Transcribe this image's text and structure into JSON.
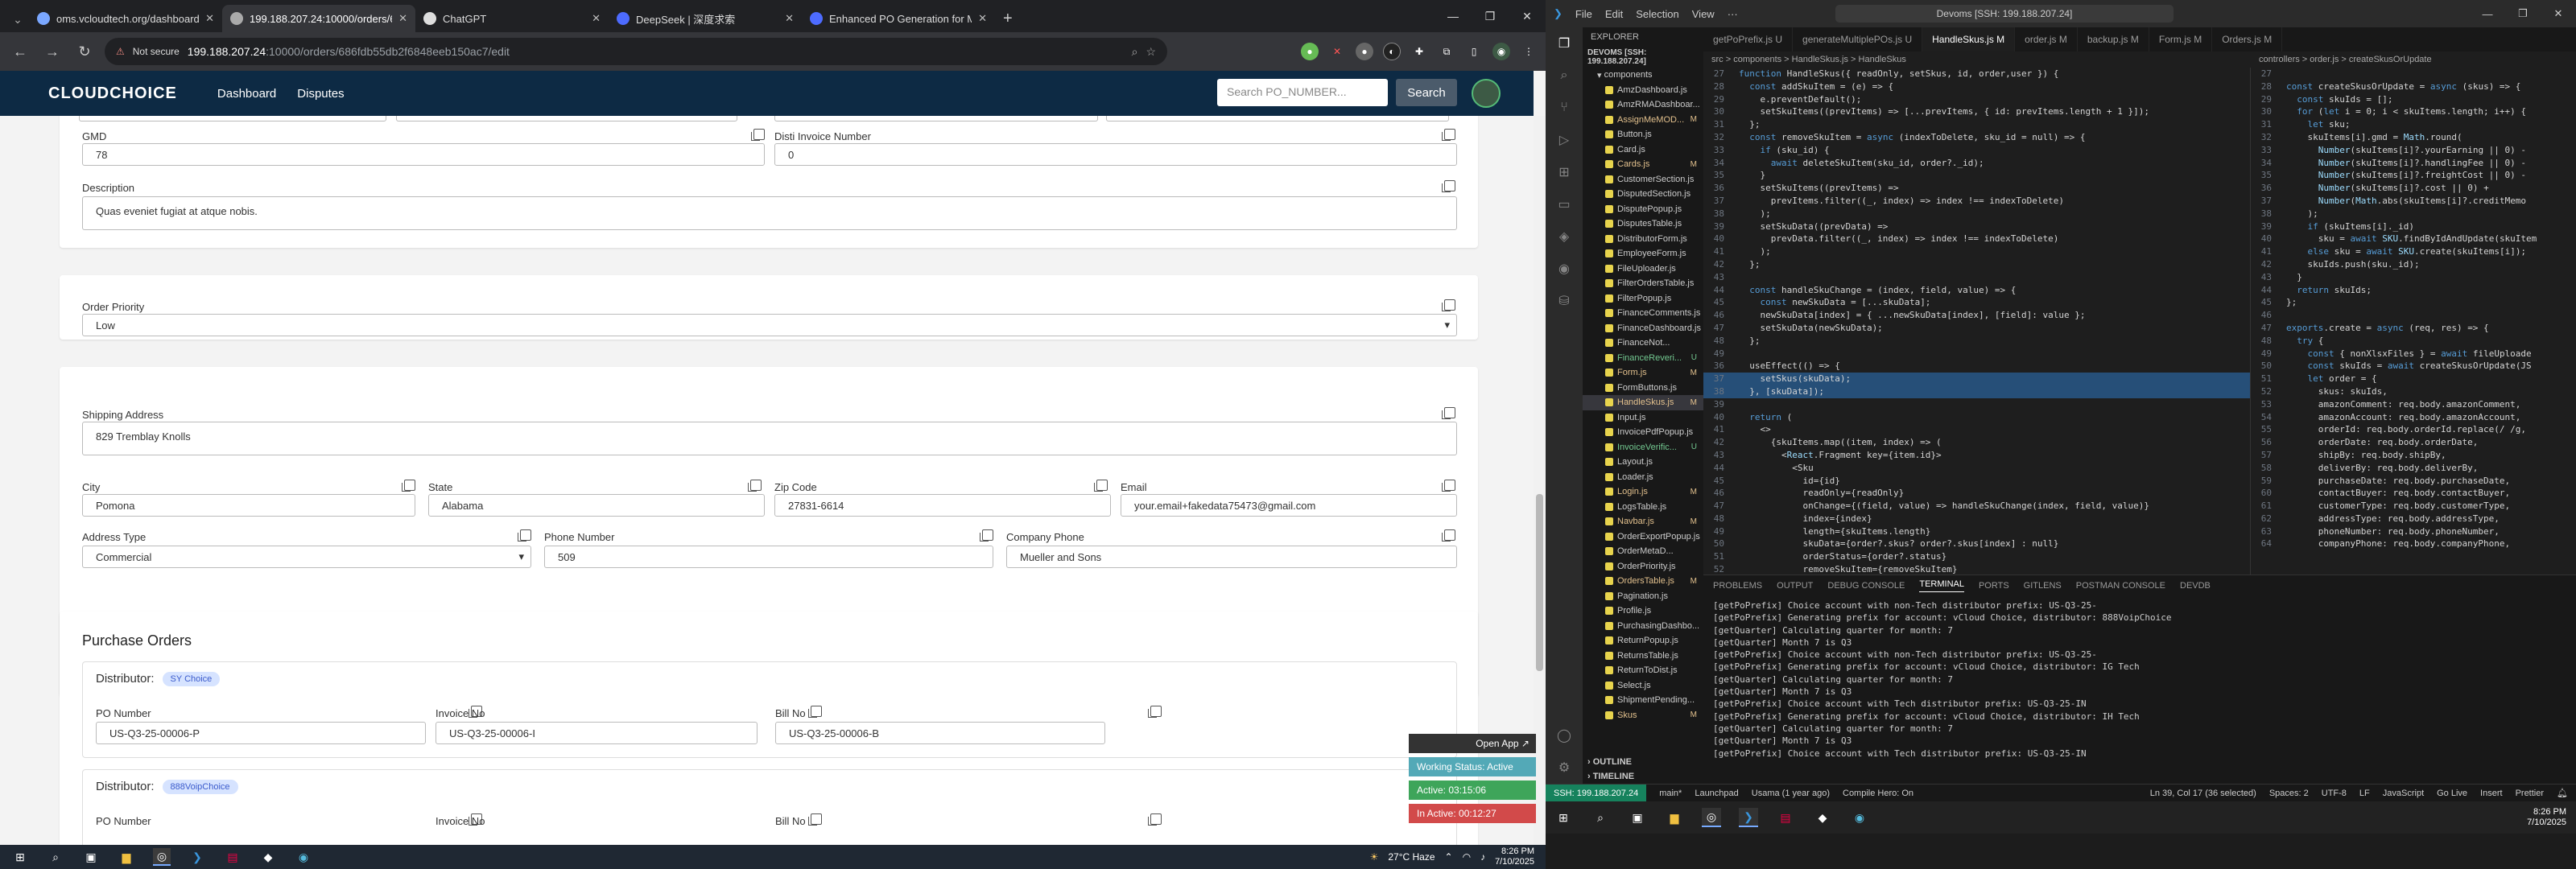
{
  "browser": {
    "tabs": [
      {
        "title": "oms.vcloudtech.org/dashboard",
        "active": false
      },
      {
        "title": "199.188.207.24:10000/orders/6",
        "active": true
      },
      {
        "title": "ChatGPT",
        "active": false
      },
      {
        "title": "DeepSeek | 深度求索",
        "active": false
      },
      {
        "title": "Enhanced PO Generation for M",
        "active": false
      }
    ],
    "address": {
      "security": "Not secure",
      "host": "199.188.207.24",
      "path": ":10000/orders/686fdb55db2f6848eeb150ac7/edit"
    }
  },
  "app": {
    "logo": "CLOUDCHOICE",
    "nav": [
      "Dashboard",
      "Disputes"
    ],
    "search_placeholder": "Search PO_NUMBER...",
    "search_button": "Search"
  },
  "form": {
    "gmd": {
      "label": "GMD",
      "value": "78"
    },
    "disti_invoice": {
      "label": "Disti Invoice Number",
      "value": "0"
    },
    "description": {
      "label": "Description",
      "value": "Quas eveniet fugiat at atque nobis."
    },
    "order_priority": {
      "label": "Order Priority",
      "value": "Low"
    },
    "shipping_address": {
      "label": "Shipping Address",
      "value": "829 Tremblay Knolls"
    },
    "city": {
      "label": "City",
      "value": "Pomona"
    },
    "state": {
      "label": "State",
      "value": "Alabama"
    },
    "zip": {
      "label": "Zip Code",
      "value": "27831-6614"
    },
    "email": {
      "label": "Email",
      "value": "your.email+fakedata75473@gmail.com"
    },
    "address_type": {
      "label": "Address Type",
      "value": "Commercial"
    },
    "phone": {
      "label": "Phone Number",
      "value": "509"
    },
    "company_phone": {
      "label": "Company Phone",
      "value": "Mueller and Sons"
    }
  },
  "purchase_orders": {
    "heading": "Purchase Orders",
    "distributor_label": "Distributor:",
    "items": [
      {
        "badge": "SY Choice",
        "po_label": "PO Number",
        "po": "US-Q3-25-00006-P",
        "inv_label": "Invoice No",
        "inv": "US-Q3-25-00006-I",
        "bill_label": "Bill No",
        "bill": "US-Q3-25-00006-B"
      },
      {
        "badge": "888VoipChoice",
        "po_label": "PO Number",
        "inv_label": "Invoice No",
        "bill_label": "Bill No"
      }
    ]
  },
  "status_widget": {
    "open_app": "Open App ↗",
    "working": "Working Status: Active",
    "active": "Active: 03:15:06",
    "inactive": "In Active: 00:12:27"
  },
  "taskbar": {
    "weather": "27°C Haze",
    "time": "8:26 PM",
    "date": "7/10/2025"
  },
  "vscode": {
    "menu": [
      "File",
      "Edit",
      "Selection",
      "View"
    ],
    "search": "Devoms [SSH: 199.188.207.24]",
    "explorer": {
      "title": "EXPLORER",
      "root": "DEVOMS [SSH: 199.188.207.24]",
      "folder": "components",
      "files": [
        {
          "n": "AmzDashboard.js",
          "s": "",
          "c": "#ccc"
        },
        {
          "n": "AmzRMADashboar...",
          "s": "",
          "c": "#ccc"
        },
        {
          "n": "AssignMeMOD...",
          "s": "M",
          "c": "#e2c08d"
        },
        {
          "n": "Button.js",
          "s": "",
          "c": "#ccc"
        },
        {
          "n": "Card.js",
          "s": "",
          "c": "#ccc"
        },
        {
          "n": "Cards.js",
          "s": "M",
          "c": "#e2c08d"
        },
        {
          "n": "CustomerSection.js",
          "s": "",
          "c": "#ccc"
        },
        {
          "n": "DisputedSection.js",
          "s": "",
          "c": "#ccc"
        },
        {
          "n": "DisputePopup.js",
          "s": "",
          "c": "#ccc"
        },
        {
          "n": "DisputesTable.js",
          "s": "",
          "c": "#ccc"
        },
        {
          "n": "DistributorForm.js",
          "s": "",
          "c": "#ccc"
        },
        {
          "n": "EmployeeForm.js",
          "s": "",
          "c": "#ccc"
        },
        {
          "n": "FileUploader.js",
          "s": "",
          "c": "#ccc"
        },
        {
          "n": "FilterOrdersTable.js",
          "s": "",
          "c": "#ccc"
        },
        {
          "n": "FilterPopup.js",
          "s": "",
          "c": "#ccc"
        },
        {
          "n": "FinanceComments.js",
          "s": "",
          "c": "#ccc"
        },
        {
          "n": "FinanceDashboard.js",
          "s": "",
          "c": "#ccc"
        },
        {
          "n": "FinanceNot...",
          "s": "",
          "c": "#ccc"
        },
        {
          "n": "FinanceReveri...",
          "s": "U",
          "c": "#73c991"
        },
        {
          "n": "Form.js",
          "s": "M",
          "c": "#e2c08d"
        },
        {
          "n": "FormButtons.js",
          "s": "",
          "c": "#ccc"
        },
        {
          "n": "HandleSkus.js",
          "s": "M",
          "c": "#e2c08d"
        },
        {
          "n": "Input.js",
          "s": "",
          "c": "#ccc"
        },
        {
          "n": "InvoicePdfPopup.js",
          "s": "",
          "c": "#ccc"
        },
        {
          "n": "InvoiceVerific...",
          "s": "U",
          "c": "#73c991"
        },
        {
          "n": "Layout.js",
          "s": "",
          "c": "#ccc"
        },
        {
          "n": "Loader.js",
          "s": "",
          "c": "#ccc"
        },
        {
          "n": "Login.js",
          "s": "M",
          "c": "#e2c08d"
        },
        {
          "n": "LogsTable.js",
          "s": "",
          "c": "#ccc"
        },
        {
          "n": "Navbar.js",
          "s": "M",
          "c": "#e2c08d"
        },
        {
          "n": "OrderExportPopup.js",
          "s": "",
          "c": "#ccc"
        },
        {
          "n": "OrderMetaD...",
          "s": "",
          "c": "#ccc"
        },
        {
          "n": "OrderPriority.js",
          "s": "",
          "c": "#ccc"
        },
        {
          "n": "OrdersTable.js",
          "s": "M",
          "c": "#e2c08d"
        },
        {
          "n": "Pagination.js",
          "s": "",
          "c": "#ccc"
        },
        {
          "n": "Profile.js",
          "s": "",
          "c": "#ccc"
        },
        {
          "n": "PurchasingDashbo...",
          "s": "",
          "c": "#ccc"
        },
        {
          "n": "ReturnPopup.js",
          "s": "",
          "c": "#ccc"
        },
        {
          "n": "ReturnsTable.js",
          "s": "",
          "c": "#ccc"
        },
        {
          "n": "ReturnToDist.js",
          "s": "",
          "c": "#ccc"
        },
        {
          "n": "Select.js",
          "s": "",
          "c": "#ccc"
        },
        {
          "n": "ShipmentPending...",
          "s": "",
          "c": "#ccc"
        },
        {
          "n": "Skus",
          "s": "M",
          "c": "#e2c08d"
        }
      ],
      "outline": "OUTLINE",
      "timeline": "TIMELINE"
    },
    "tabs": [
      "getPoPrefix.js U",
      "generateMultiplePOs.js U",
      "HandleSkus.js M",
      "order.js M",
      "backup.js M",
      "Form.js M",
      "Orders.js M"
    ],
    "breadcrumb_left": "src > components > HandleSkus.js > HandleSkus",
    "breadcrumb_right": "controllers > order.js > createSkusOrUpdate",
    "panel_tabs": [
      "PROBLEMS",
      "OUTPUT",
      "DEBUG CONSOLE",
      "TERMINAL",
      "PORTS",
      "GITLENS",
      "POSTMAN CONSOLE",
      "DEVDB"
    ],
    "terminal": [
      "[getPoPrefix] Choice account with non-Tech distributor prefix: US-Q3-25-",
      "[getPoPrefix] Generating prefix for account: vCloud Choice, distributor: 888VoipChoice",
      "[getQuarter] Calculating quarter for month: 7",
      "[getQuarter] Month 7 is Q3",
      "[getPoPrefix] Choice account with non-Tech distributor prefix: US-Q3-25-",
      "[getPoPrefix] Generating prefix for account: vCloud Choice, distributor: IG Tech",
      "[getQuarter] Calculating quarter for month: 7",
      "[getQuarter] Month 7 is Q3",
      "[getPoPrefix] Choice account with Tech distributor prefix: US-Q3-25-IN",
      "[getPoPrefix] Generating prefix for account: vCloud Choice, distributor: IH Tech",
      "[getQuarter] Calculating quarter for month: 7",
      "[getQuarter] Month 7 is Q3",
      "[getPoPrefix] Choice account with Tech distributor prefix: US-Q3-25-IN"
    ],
    "status": {
      "remote": "SSH: 199.188.207.24",
      "branch": "main*",
      "launchpad": "Launchpad",
      "author": "Usama (1 year ago)",
      "compile": "Compile Hero: On",
      "pos": "Ln 39, Col 17 (36 selected)",
      "spaces": "Spaces: 2",
      "enc": "UTF-8",
      "eol": "LF",
      "lang": "JavaScript",
      "golive": "Go Live",
      "insert": "Insert",
      "prettier": "Prettier"
    },
    "clock": {
      "time": "8:26 PM",
      "date": "7/10/2025"
    }
  },
  "code_left": [
    {
      "n": "27",
      "t": "function HandleSkus({ readOnly, setSkus, id, order,user }) {"
    },
    {
      "n": "28",
      "t": "  const addSkuItem = (e) => {"
    },
    {
      "n": "29",
      "t": "    e.preventDefault();"
    },
    {
      "n": "30",
      "t": "    setSkuItems((prevItems) => [...prevItems, { id: prevItems.length + 1 }]);"
    },
    {
      "n": "31",
      "t": "  };"
    },
    {
      "n": "32",
      "t": "  const removeSkuItem = async (indexToDelete, sku_id = null) => {"
    },
    {
      "n": "33",
      "t": "    if (sku_id) {"
    },
    {
      "n": "34",
      "t": "      await deleteSkuItem(sku_id, order?._id);"
    },
    {
      "n": "35",
      "t": "    }"
    },
    {
      "n": "36",
      "t": "    setSkuItems((prevItems) =>"
    },
    {
      "n": "37",
      "t": "      prevItems.filter((_, index) => index !== indexToDelete)"
    },
    {
      "n": "38",
      "t": "    );"
    },
    {
      "n": "39",
      "t": "    setSkuData((prevData) =>"
    },
    {
      "n": "40",
      "t": "      prevData.filter((_, index) => index !== indexToDelete)"
    },
    {
      "n": "41",
      "t": "    );"
    },
    {
      "n": "42",
      "t": "  };"
    },
    {
      "n": "43",
      "t": ""
    },
    {
      "n": "44",
      "t": "  const handleSkuChange = (index, field, value) => {"
    },
    {
      "n": "45",
      "t": "    const newSkuData = [...skuData];"
    },
    {
      "n": "46",
      "t": "    newSkuData[index] = { ...newSkuData[index], [field]: value };"
    },
    {
      "n": "47",
      "t": "    setSkuData(newSkuData);"
    },
    {
      "n": "48",
      "t": "  };"
    },
    {
      "n": "49",
      "t": ""
    },
    {
      "n": "36",
      "t": "  useEffect(() => {"
    },
    {
      "n": "37",
      "t": "    setSkus(skuData);"
    },
    {
      "n": "38",
      "t": "  }, [skuData]);"
    },
    {
      "n": "39",
      "t": ""
    },
    {
      "n": "40",
      "t": "  return ("
    },
    {
      "n": "41",
      "t": "    <>"
    },
    {
      "n": "42",
      "t": "      {skuItems.map((item, index) => ("
    },
    {
      "n": "43",
      "t": "        <React.Fragment key={item.id}>"
    },
    {
      "n": "44",
      "t": "          <Sku"
    },
    {
      "n": "45",
      "t": "            id={id}"
    },
    {
      "n": "46",
      "t": "            readOnly={readOnly}"
    },
    {
      "n": "47",
      "t": "            onChange={(field, value) => handleSkuChange(index, field, value)}"
    },
    {
      "n": "48",
      "t": "            index={index}"
    },
    {
      "n": "49",
      "t": "            length={skuItems.length}"
    },
    {
      "n": "50",
      "t": "            skuData={order?.skus? order?.skus[index] : null}"
    },
    {
      "n": "51",
      "t": "            orderStatus={order?.status}"
    },
    {
      "n": "52",
      "t": "            removeSkuItem={removeSkuItem}"
    }
  ],
  "code_right": [
    {
      "n": "27",
      "t": ""
    },
    {
      "n": "28",
      "t": "const createSkusOrUpdate = async (skus) => {"
    },
    {
      "n": "29",
      "t": "  const skuIds = [];"
    },
    {
      "n": "30",
      "t": "  for (let i = 0; i < skuItems.length; i++) {"
    },
    {
      "n": "31",
      "t": "    let sku;"
    },
    {
      "n": "32",
      "t": "    skuItems[i].gmd = Math.round("
    },
    {
      "n": "33",
      "t": "      Number(skuItems[i]?.yourEarning || 0) -"
    },
    {
      "n": "34",
      "t": "      Number(skuItems[i]?.handlingFee || 0) -"
    },
    {
      "n": "35",
      "t": "      Number(skuItems[i]?.freightCost || 0) -"
    },
    {
      "n": "36",
      "t": "      Number(skuItems[i]?.cost || 0) +"
    },
    {
      "n": "37",
      "t": "      Number(Math.abs(skuItems[i]?.creditMemo"
    },
    {
      "n": "38",
      "t": "    );"
    },
    {
      "n": "39",
      "t": "    if (skuItems[i]._id)"
    },
    {
      "n": "40",
      "t": "      sku = await SKU.findByIdAndUpdate(skuItem"
    },
    {
      "n": "41",
      "t": "    else sku = await SKU.create(skuItems[i]);"
    },
    {
      "n": "42",
      "t": "    skuIds.push(sku._id);"
    },
    {
      "n": "43",
      "t": "  }"
    },
    {
      "n": "44",
      "t": "  return skuIds;"
    },
    {
      "n": "45",
      "t": "};"
    },
    {
      "n": "46",
      "t": ""
    },
    {
      "n": "47",
      "t": "exports.create = async (req, res) => {"
    },
    {
      "n": "48",
      "t": "  try {"
    },
    {
      "n": "49",
      "t": "    const { nonXlsxFiles } = await fileUploade"
    },
    {
      "n": "50",
      "t": "    const skuIds = await createSkusOrUpdate(JS"
    },
    {
      "n": "51",
      "t": "    let order = {"
    },
    {
      "n": "52",
      "t": "      skus: skuIds,"
    },
    {
      "n": "53",
      "t": "      amazonComment: req.body.amazonComment,"
    },
    {
      "n": "54",
      "t": "      amazonAccount: req.body.amazonAccount,"
    },
    {
      "n": "55",
      "t": "      orderId: req.body.orderId.replace(/ /g,"
    },
    {
      "n": "56",
      "t": "      orderDate: req.body.orderDate,"
    },
    {
      "n": "57",
      "t": "      shipBy: req.body.shipBy,"
    },
    {
      "n": "58",
      "t": "      deliverBy: req.body.deliverBy,"
    },
    {
      "n": "59",
      "t": "      purchaseDate: req.body.purchaseDate,"
    },
    {
      "n": "60",
      "t": "      contactBuyer: req.body.contactBuyer,"
    },
    {
      "n": "61",
      "t": "      customerType: req.body.customerType,"
    },
    {
      "n": "62",
      "t": "      addressType: req.body.addressType,"
    },
    {
      "n": "63",
      "t": "      phoneNumber: req.body.phoneNumber,"
    },
    {
      "n": "64",
      "t": "      companyPhone: req.body.companyPhone,"
    }
  ]
}
